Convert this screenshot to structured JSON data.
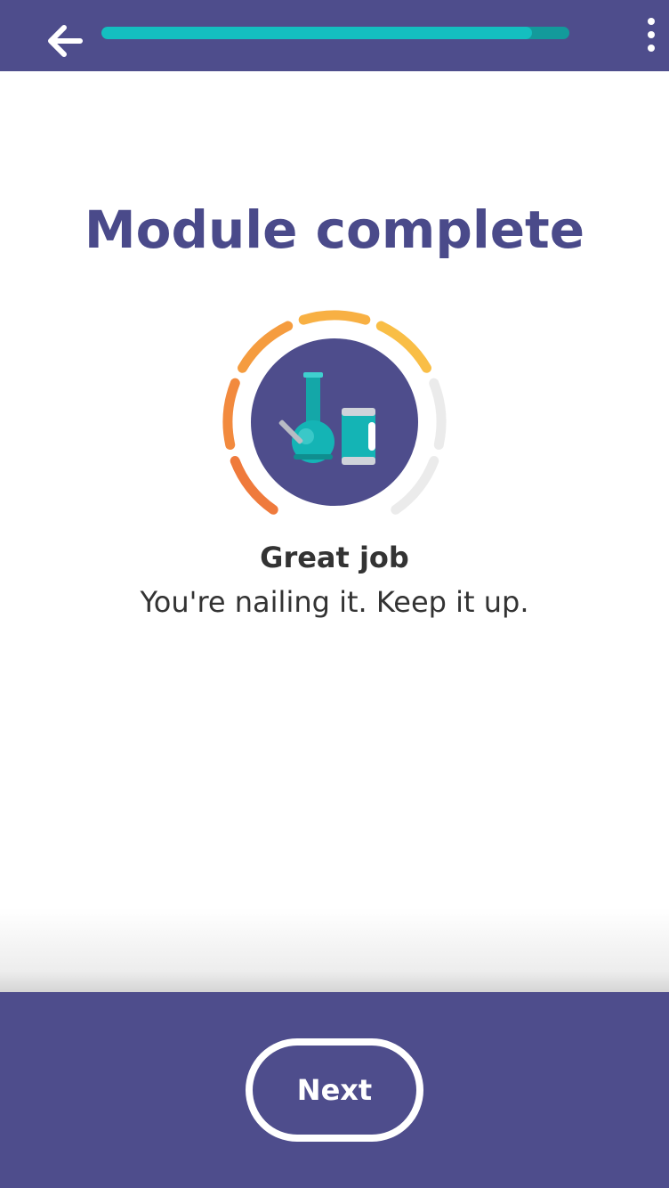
{
  "topbar": {
    "progress": 0.92,
    "colors": {
      "bar": "#4e4d8c",
      "progress_fill": "#14bfc0",
      "progress_track": "#139a9b"
    }
  },
  "main": {
    "title": "Module complete",
    "badge": {
      "icons": [
        "bong-icon",
        "can-icon"
      ],
      "ring_segments_filled": 5,
      "ring_segments_total": 7
    },
    "headline": "Great job",
    "message": "You're nailing it. Keep it up."
  },
  "footer": {
    "next_label": "Next"
  },
  "colors": {
    "accent": "#4a4a8a",
    "text": "#333333"
  }
}
